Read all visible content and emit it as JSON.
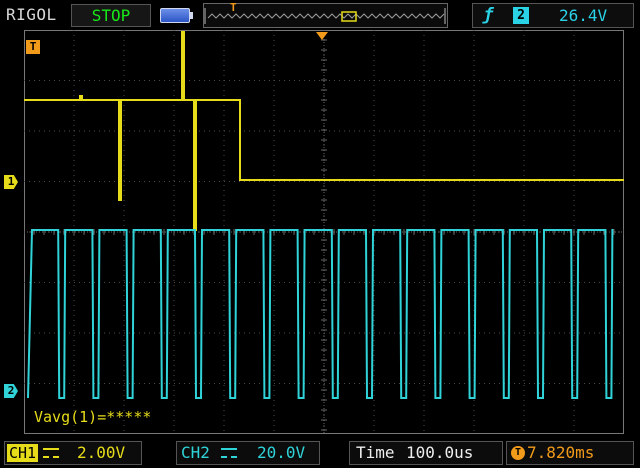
{
  "top_bar": {
    "brand": "RIGOL",
    "run_state": "STOP",
    "battery_icon": "battery-icon",
    "memory_marker": "T",
    "trigger": {
      "edge_icon": "rising-edge-icon",
      "source": "2",
      "level": "26.4V"
    }
  },
  "screen": {
    "trigger_marker": "T",
    "ch1_marker": "1",
    "ch2_marker": "2",
    "measurement": "Vavg(1)=*****"
  },
  "bottom_bar": {
    "ch1": {
      "name": "CH1",
      "coupling_icon": "dc-coupling-icon",
      "scale": "2.00V"
    },
    "ch2": {
      "name": "CH2",
      "coupling_icon": "dc-coupling-icon",
      "scale": "20.0V"
    },
    "time": {
      "label": "Time",
      "value": "100.0us"
    },
    "trigger_offset": {
      "icon": "T",
      "value": "7.820ms"
    }
  },
  "colors": {
    "ch1": "#e6dc1a",
    "ch2": "#2fd3d8",
    "trigger": "#f29a1a",
    "grid": "#4a4a4a",
    "run_state": "#18e818"
  }
}
